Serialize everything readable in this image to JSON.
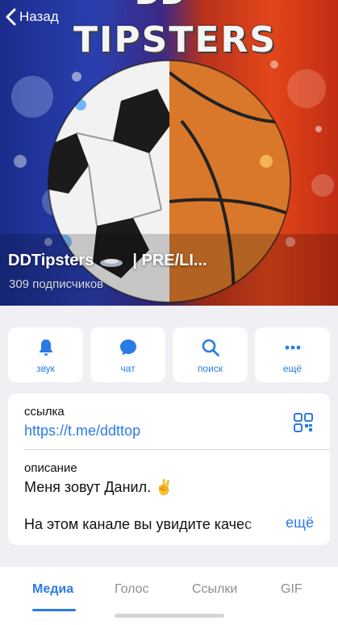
{
  "nav": {
    "back_label": "Назад"
  },
  "cover": {
    "brand_text": "TIPSTERS",
    "brand_top_text": "DD",
    "channel_name_left": "DDTipsters",
    "channel_name_right": "| PRE/LI...",
    "subscribers": "309 подписчиков"
  },
  "actions": [
    {
      "label": "звук",
      "icon": "bell-icon"
    },
    {
      "label": "чат",
      "icon": "chat-icon"
    },
    {
      "label": "поиск",
      "icon": "search-icon"
    },
    {
      "label": "ещё",
      "icon": "more-dots-icon"
    }
  ],
  "info": {
    "link_caption": "ссылка",
    "link_value": "https://t.me/ddttop",
    "description_caption": "описание",
    "description_line1": "Меня зовут Данил. ✌️",
    "description_line2": "На этом канале вы увидите качес",
    "more_label": "ещё"
  },
  "tabs": [
    {
      "label": "Медиа",
      "active": true
    },
    {
      "label": "Голос",
      "active": false
    },
    {
      "label": "Ссылки",
      "active": false
    },
    {
      "label": "GIF",
      "active": false
    }
  ],
  "colors": {
    "accent": "#2a7be4",
    "background": "#efeff4"
  }
}
